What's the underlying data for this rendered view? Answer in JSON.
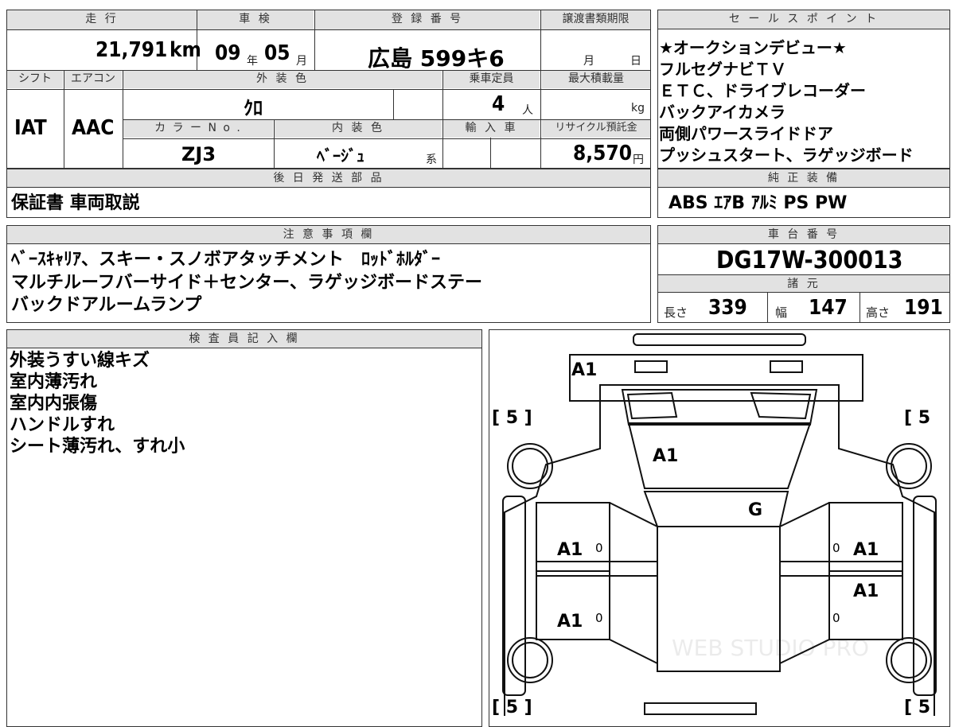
{
  "headers": {
    "mileage": "走 行",
    "inspection": "車 検",
    "registration": "登 録 番 号",
    "transfer_deadline": "譲渡書類期限",
    "shift": "シフト",
    "aircon": "エアコン",
    "exterior_color": "外 装 色",
    "capacity": "乗車定員",
    "max_load": "最大積載量",
    "color_no": "カ ラ ー  N o .",
    "interior_color": "内 装 色",
    "import": "輸 入 車",
    "recycle": "リサイクル預託金",
    "later_parts": "後 日 発 送 部 品",
    "sales_points": "セ ー ル ス ポ イ ン ト",
    "genuine_equipment": "純 正 装 備",
    "notes": "注 意 事 項 欄",
    "chassis_no": "車 台 番 号",
    "specs": "諸 元",
    "inspector": "検 査 員 記 入 欄"
  },
  "vehicle": {
    "mileage_value": "21,791",
    "mileage_unit": "km",
    "inspection_year": "09",
    "year_unit": "年",
    "inspection_month": "05",
    "month_unit": "月",
    "registration": "広島 599キ6",
    "deadline_month": "月",
    "deadline_day": "日",
    "shift": "IAT",
    "aircon": "AAC",
    "exterior_color": "ｸﾛ",
    "capacity": "4",
    "capacity_unit": "人",
    "max_load_unit": "kg",
    "color_no": "ZJ3",
    "interior_color": "ﾍﾞｰｼﾞｭ",
    "interior_suffix": "系",
    "recycle_fee": "8,570",
    "recycle_unit": "円",
    "later_parts": "保証書 車両取説"
  },
  "sales_points": [
    "★オークションデビュー★",
    "フルセグナビＴＶ",
    "ＥＴＣ、ドライブレコーダー",
    "バックアイカメラ",
    "両側パワースライドドア",
    "プッシュスタート、ラゲッジボード"
  ],
  "genuine_equipment": "ABS ｴｱB ｱﾙﾐ PS PW",
  "notes": [
    "ﾍﾞｰｽｷｬﾘｱ、スキー・スノボアタッチメント　ﾛｯﾄﾞﾎﾙﾀﾞｰ",
    "マルチルーフバーサイド＋センター、ラゲッジボードステー",
    "バックドアルームランプ"
  ],
  "chassis_no": "DG17W-300013",
  "specs": {
    "length_label": "長さ",
    "length": "339",
    "width_label": "幅",
    "width": "147",
    "height_label": "高さ",
    "height": "191"
  },
  "inspector_notes": [
    "外装うすい線キズ",
    "室内薄汚れ",
    "室内内張傷",
    "ハンドルすれ",
    "シート薄汚れ、すれ小"
  ],
  "diagram": {
    "tire_label_tl": "[ 5 ]",
    "tire_label_tr": "[ 5",
    "tire_label_bl": "[ 5 ]",
    "tire_label_br": "[ 5",
    "mark_rear": "A1",
    "mark_roof": "A1",
    "mark_glass": "G",
    "mark_left_front": "A1",
    "mark_left_rear": "A1",
    "mark_right_front": "A1",
    "mark_right_rear": "A1",
    "zero1": "0",
    "zero2": "0",
    "zero3": "0",
    "zero4": "0",
    "watermark": "WEB STUDIO PRO"
  }
}
